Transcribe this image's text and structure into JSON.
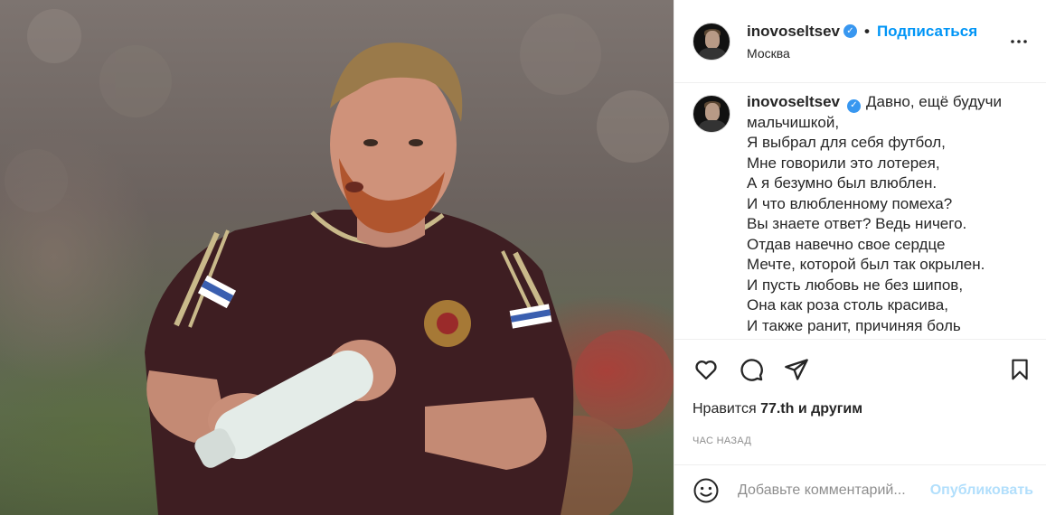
{
  "post": {
    "author": {
      "username": "inovoseltsev",
      "verified": true,
      "location": "Москва"
    },
    "follow_label": "Подписаться",
    "separator": "•",
    "caption_lines": [
      "Давно, ещё будучи",
      "мальчишкой,",
      "Я выбрал для себя футбол,",
      "Мне говорили это лотерея,",
      "А я безумно был влюблен.",
      "И что влюбленному помеха?",
      "Вы знаете ответ? Ведь ничего.",
      "Отдав навечно свое сердце",
      "Мечте, которой был так окрылен.",
      "И пусть любовь не без шипов,",
      "Она как роза столь красива,",
      "И также ранит, причиняя боль"
    ],
    "likes": {
      "prefix": "Нравится",
      "count": "77.th",
      "suffix": "и другим"
    },
    "time_ago": "ЧАС НАЗАД",
    "comment": {
      "placeholder": "Добавьте комментарий...",
      "publish_label": "Опубликовать"
    },
    "icons": {
      "more": "more-options-icon",
      "like": "heart-icon",
      "comment": "comment-icon",
      "share": "share-icon",
      "save": "bookmark-icon",
      "emoji": "emoji-icon"
    },
    "colors": {
      "accent": "#0095f6",
      "publish_disabled": "#b2dffc",
      "verified": "#3897f0",
      "muted": "#8e8e8e"
    }
  }
}
